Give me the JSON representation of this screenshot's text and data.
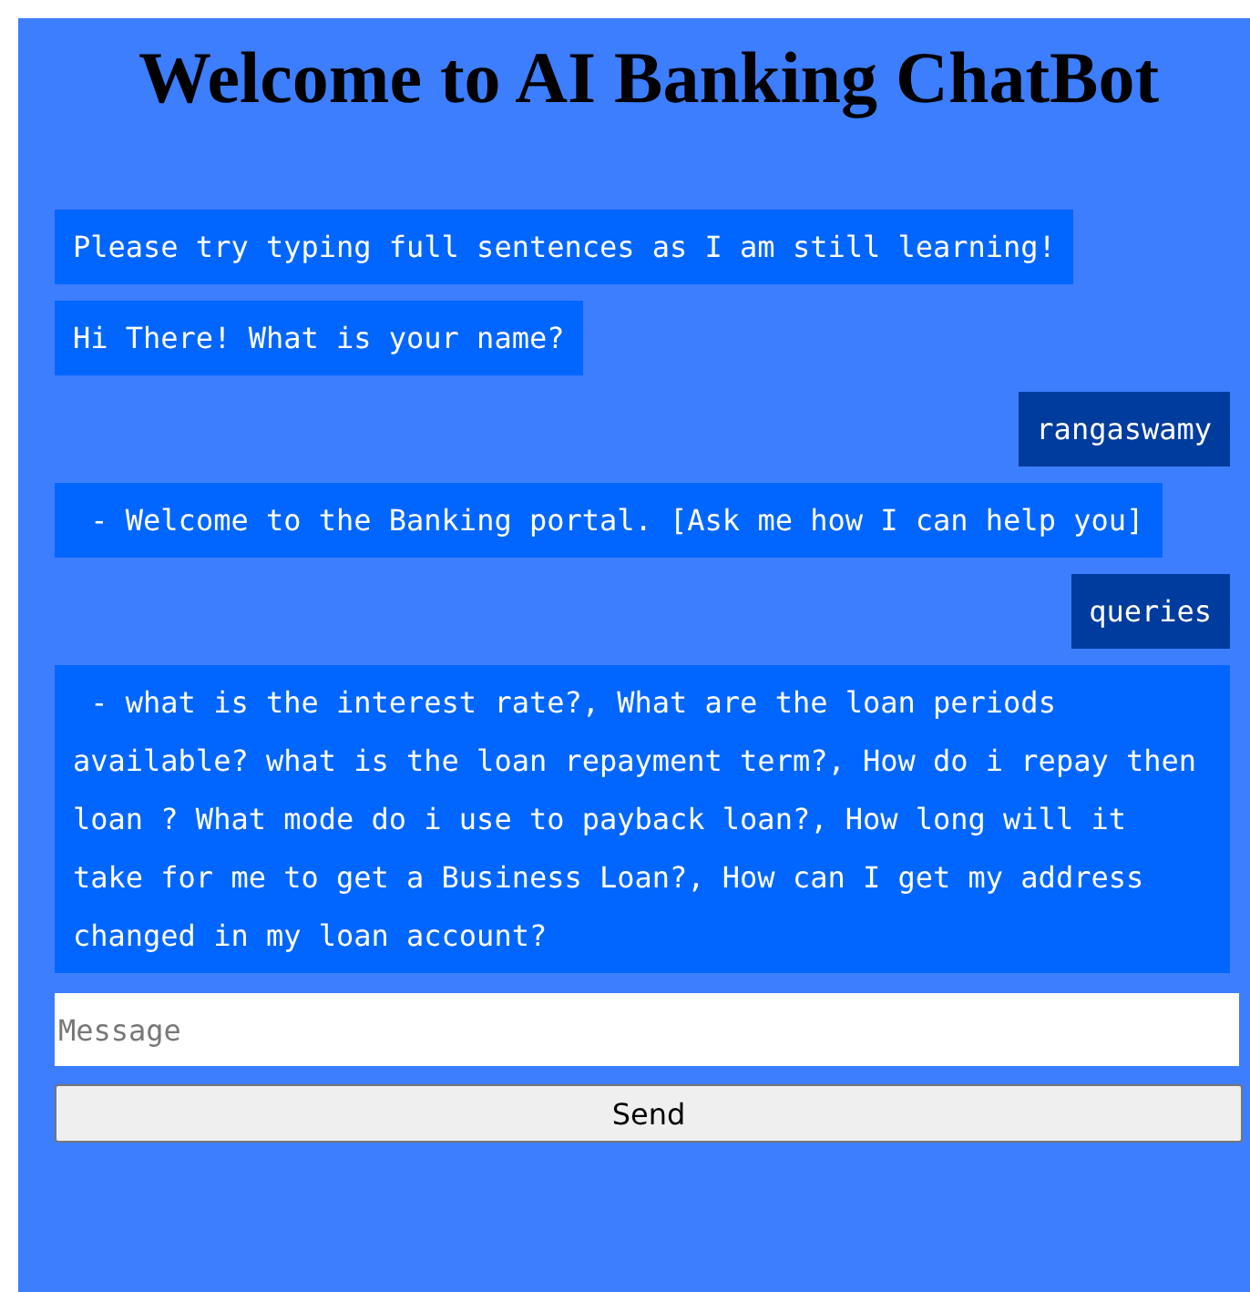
{
  "title": "Welcome to AI Banking ChatBot",
  "messages": [
    {
      "kind": "bot",
      "text": "Please try typing full sentences as I am still learning!"
    },
    {
      "kind": "bot",
      "text": "Hi There! What is your name?"
    },
    {
      "kind": "user",
      "text": "rangaswamy"
    },
    {
      "kind": "bot",
      "text": " - Welcome to the Banking portal. [Ask me how I can help you]"
    },
    {
      "kind": "user",
      "text": "queries"
    },
    {
      "kind": "bot",
      "text": " - what is the interest rate?, What are the loan periods available? what is the loan repayment term?, How do i repay then loan ? What mode do i use to payback loan?, How long will it take for me to get a Business Loan?, How can I get my address changed in my loan account?"
    }
  ],
  "input": {
    "placeholder": "Message"
  },
  "send_button": "Send"
}
